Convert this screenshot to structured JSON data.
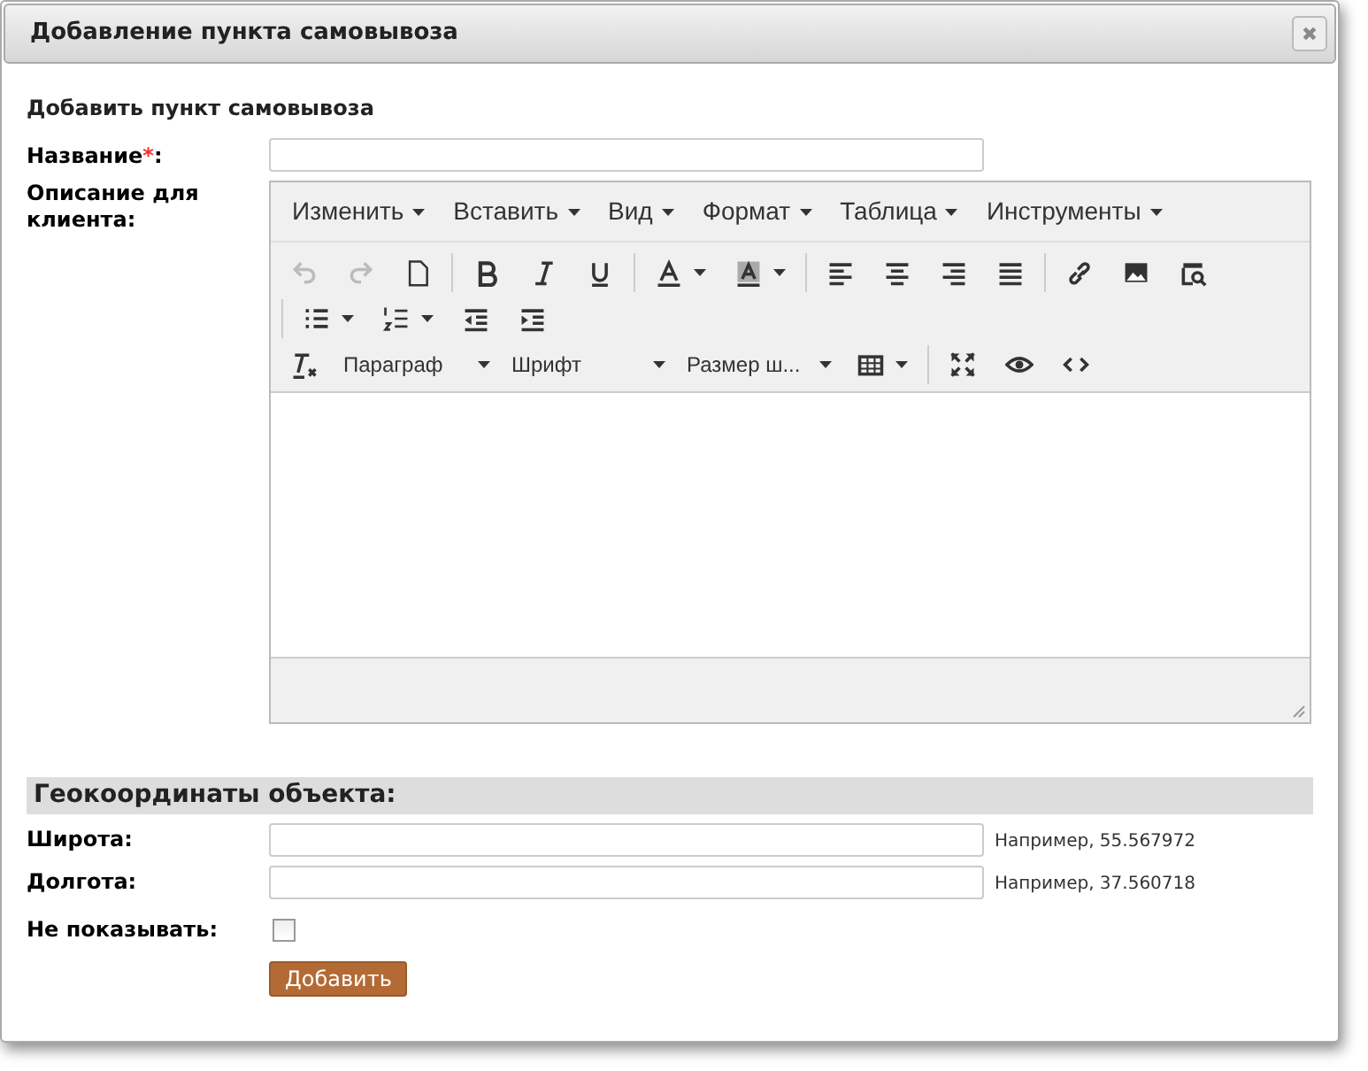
{
  "window": {
    "title": "Добавление пункта самовывоза",
    "close": "✖"
  },
  "heading": "Добавить пункт самовывоза",
  "name_field": {
    "label": "Название",
    "required_mark": "*",
    "colon": ":"
  },
  "description": {
    "label": "Описание для клиента:",
    "menu": [
      "Изменить",
      "Вставить",
      "Вид",
      "Формат",
      "Таблица",
      "Инструменты"
    ],
    "toolbar_rows": [
      [
        {
          "kind": "button",
          "disabled": true
        },
        {
          "kind": "button",
          "disabled": true
        },
        {
          "kind": "button",
          "disabled": false
        },
        {
          "kind": "separator"
        },
        {
          "kind": "button",
          "disabled": false
        },
        {
          "kind": "button",
          "disabled": false
        },
        {
          "kind": "button",
          "disabled": false
        },
        {
          "kind": "separator"
        },
        {
          "kind": "split",
          "disabled": false
        },
        {
          "kind": "split",
          "disabled": false
        },
        {
          "kind": "separator"
        },
        {
          "kind": "button",
          "disabled": false
        },
        {
          "kind": "button",
          "disabled": false
        },
        {
          "kind": "button",
          "disabled": false
        },
        {
          "kind": "button",
          "disabled": false
        },
        {
          "kind": "separator"
        },
        {
          "kind": "button",
          "disabled": false
        },
        {
          "kind": "button",
          "disabled": false
        },
        {
          "kind": "button",
          "disabled": false
        }
      ],
      [
        {
          "kind": "separator"
        },
        {
          "kind": "split",
          "disabled": false
        },
        {
          "kind": "split",
          "disabled": false
        },
        {
          "kind": "button",
          "disabled": false
        },
        {
          "kind": "button",
          "disabled": false
        }
      ],
      [
        {
          "kind": "button",
          "disabled": false
        },
        {
          "kind": "dropdown",
          "label": "Параграф"
        },
        {
          "kind": "dropdown",
          "label": "Шрифт"
        },
        {
          "kind": "dropdown",
          "label": "Размер ш..."
        },
        {
          "kind": "split",
          "disabled": false
        },
        {
          "kind": "separator"
        },
        {
          "kind": "button",
          "disabled": false
        },
        {
          "kind": "button",
          "disabled": false
        },
        {
          "kind": "button",
          "disabled": false
        }
      ]
    ]
  },
  "geo": {
    "title": "Геокоординаты объекта:",
    "fields": [
      {
        "label": "Широта:",
        "hint": "Например, 55.567972"
      },
      {
        "label": "Долгота:",
        "hint": "Например, 37.560718"
      }
    ]
  },
  "hide": {
    "label": "Не показывать:",
    "checked": false
  },
  "submit": "Добавить"
}
